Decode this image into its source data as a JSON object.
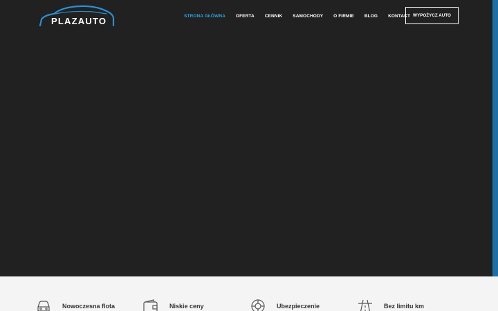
{
  "logo": {
    "text": "PLAZAUTO",
    "icon": "car-outline-logo"
  },
  "nav": {
    "items": [
      {
        "label": "STRONA GŁÓWNA",
        "active": true
      },
      {
        "label": "OFERTA"
      },
      {
        "label": "CENNIK"
      },
      {
        "label": "SAMOCHODY"
      },
      {
        "label": "O FIRMIE"
      },
      {
        "label": "BLOG"
      },
      {
        "label": "KONTAKT"
      }
    ],
    "cta_label": "WYPOŻYCZ AUTO"
  },
  "features": [
    {
      "label": "Nowoczesna flota",
      "icon": "car-icon"
    },
    {
      "label": "Niskie ceny",
      "icon": "wallet-icon"
    },
    {
      "label": "Ubezpieczenie",
      "icon": "lifebuoy-icon"
    },
    {
      "label": "Bez limitu km",
      "icon": "road-icon"
    }
  ],
  "colors": {
    "hero_bg": "#212121",
    "accent": "#2ea3e0",
    "accent_bar": "#1e6fa6",
    "features_bg": "#f4f4f4"
  }
}
